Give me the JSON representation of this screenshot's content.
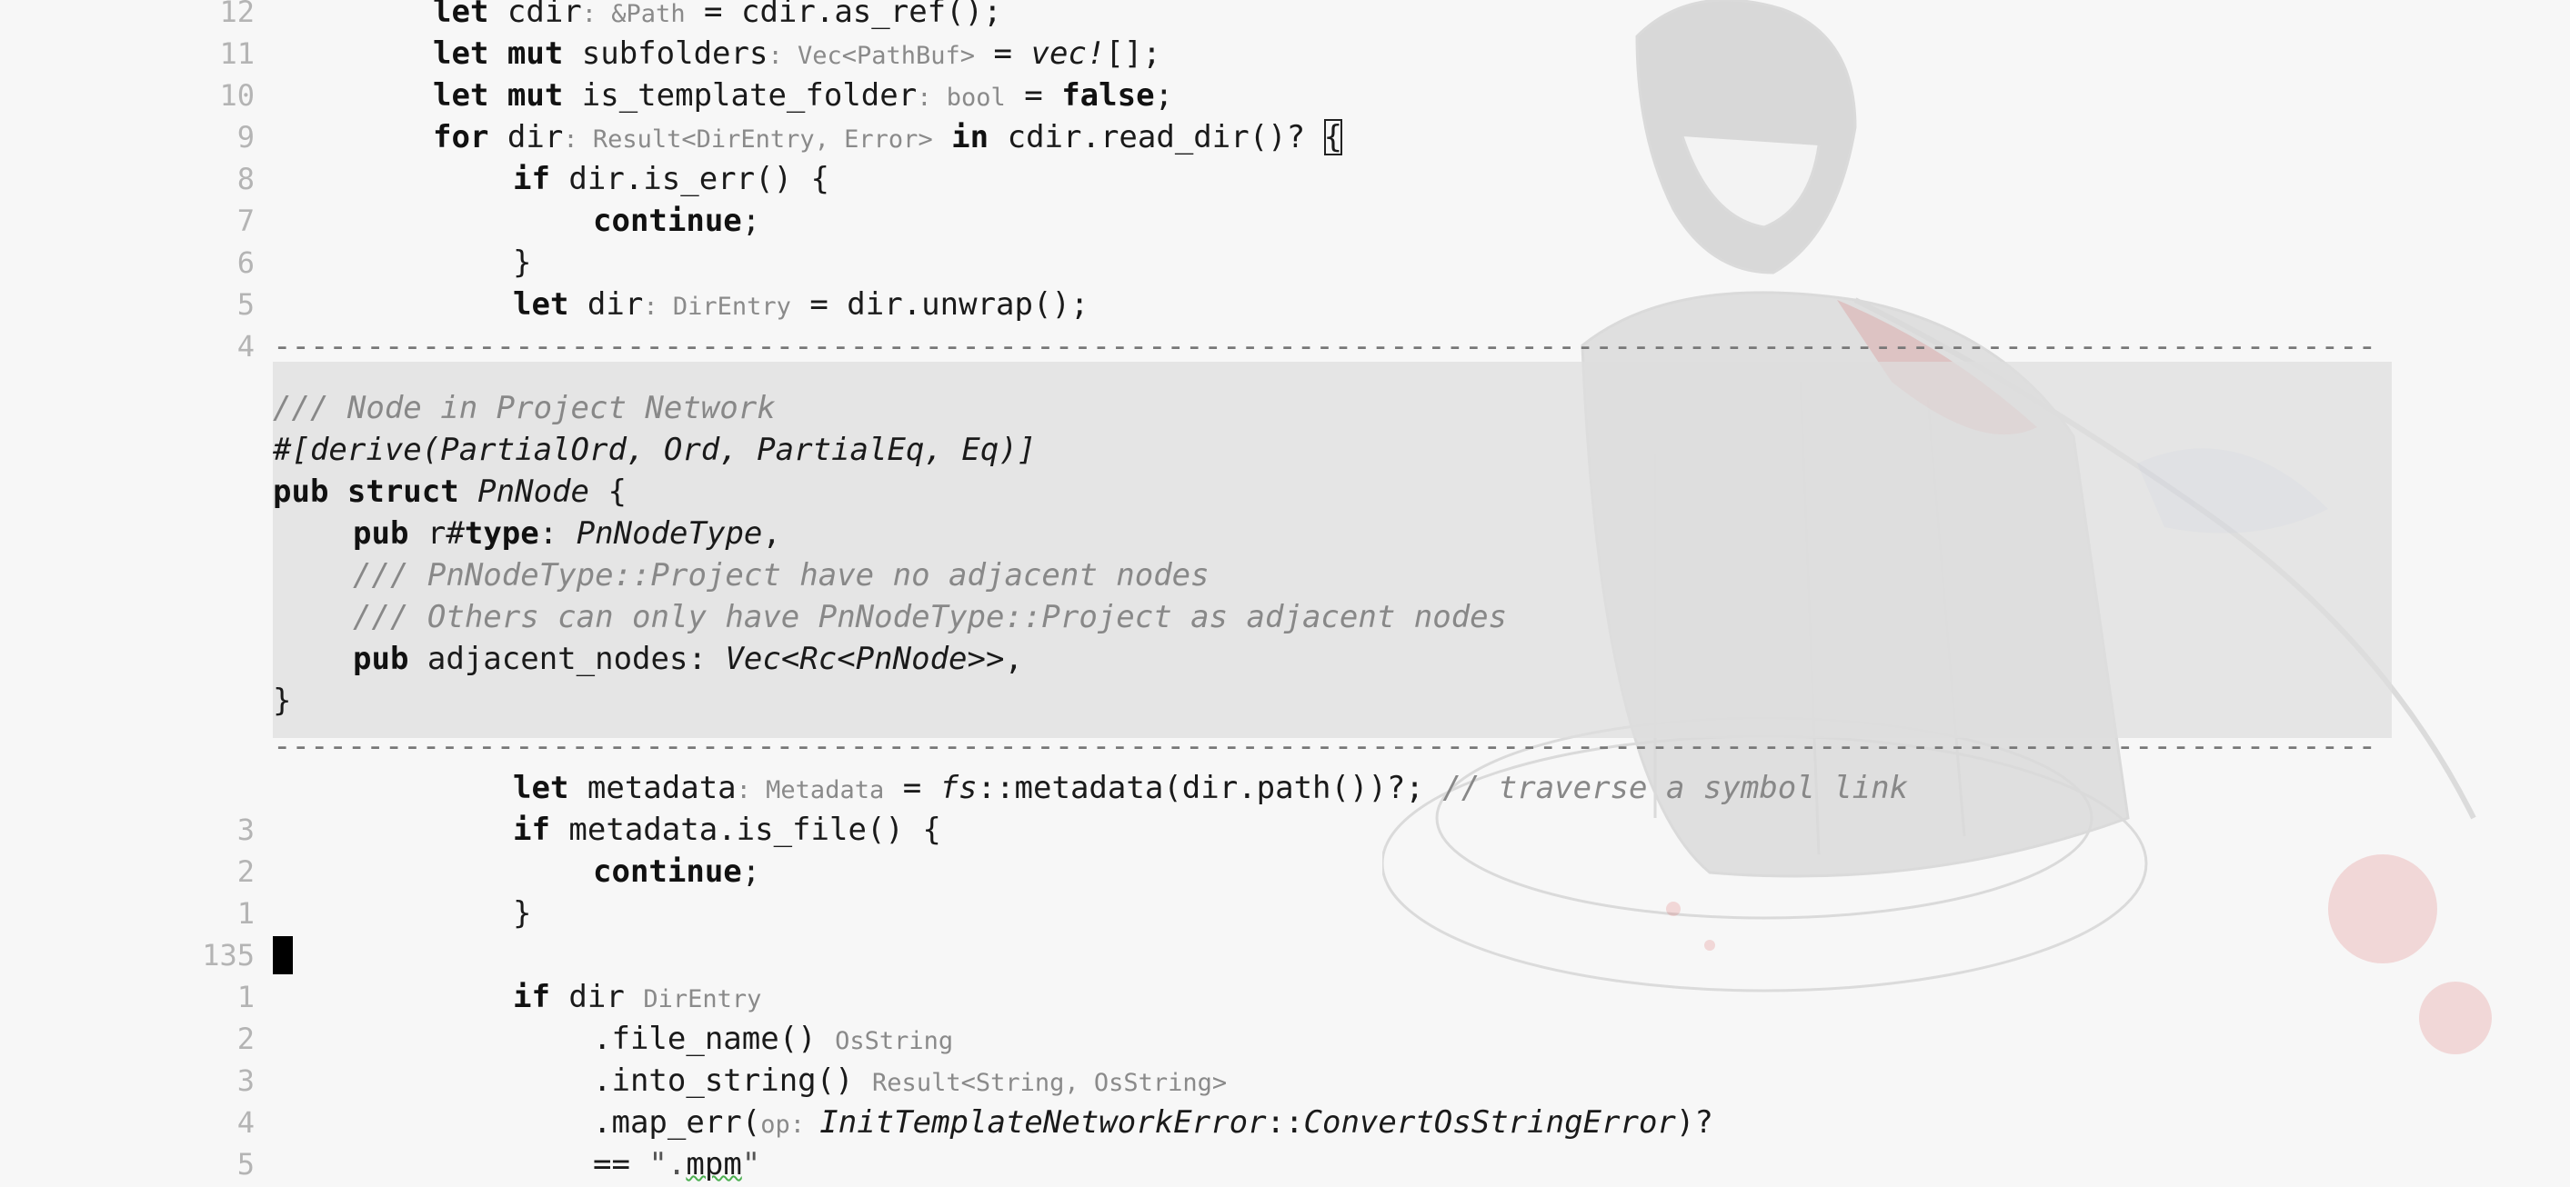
{
  "editor": {
    "lines_top": [
      {
        "num": "12",
        "parts": [
          [
            "kw",
            "let "
          ],
          [
            "",
            "cdir"
          ],
          [
            "hint",
            ": &Path"
          ],
          [
            "",
            " = cdir.as_ref();"
          ]
        ],
        "indent": 2
      },
      {
        "num": "11",
        "parts": [
          [
            "kw",
            "let mut "
          ],
          [
            "",
            "subfolders"
          ],
          [
            "hint",
            ": Vec<PathBuf>"
          ],
          [
            "",
            " = "
          ],
          [
            "it",
            "vec!"
          ],
          [
            "",
            "[];"
          ]
        ],
        "indent": 2
      },
      {
        "num": "10",
        "parts": [
          [
            "kw",
            "let mut "
          ],
          [
            "",
            "is_template_folder"
          ],
          [
            "hint",
            ": bool"
          ],
          [
            "",
            " = "
          ],
          [
            "kw",
            "false"
          ],
          [
            "",
            ";"
          ]
        ],
        "indent": 2
      },
      {
        "num": "9",
        "parts": [
          [
            "kw",
            "for "
          ],
          [
            "",
            "dir"
          ],
          [
            "hint",
            ": Result<DirEntry, Error>"
          ],
          [
            "kw",
            " in "
          ],
          [
            "",
            "cdir.read_dir()? "
          ],
          [
            "bracket",
            "{"
          ]
        ],
        "indent": 2
      },
      {
        "num": "8",
        "parts": [
          [
            "kw",
            "if "
          ],
          [
            "",
            "dir.is_err() {"
          ]
        ],
        "indent": 3
      },
      {
        "num": "7",
        "parts": [
          [
            "kw",
            "continue"
          ],
          [
            "",
            ";"
          ]
        ],
        "indent": 4
      },
      {
        "num": "6",
        "parts": [
          [
            "",
            "}"
          ]
        ],
        "indent": 3
      },
      {
        "num": "5",
        "parts": [
          [
            "kw",
            "let "
          ],
          [
            "",
            "dir"
          ],
          [
            "hint",
            ": DirEntry"
          ],
          [
            "",
            " = dir.unwrap();"
          ]
        ],
        "indent": 3
      }
    ],
    "sep_top_num": "4",
    "popup_lines": [
      {
        "parts": [
          [
            "cm",
            "/// Node in Project Network"
          ]
        ],
        "indent": 0
      },
      {
        "parts": [
          [
            "it",
            "#[derive(PartialOrd, Ord, PartialEq, Eq)]"
          ]
        ],
        "indent": 0
      },
      {
        "parts": [
          [
            "kw",
            "pub struct "
          ],
          [
            "it",
            "PnNode"
          ],
          [
            "",
            " {"
          ]
        ],
        "indent": 0
      },
      {
        "parts": [
          [
            "kw",
            "pub "
          ],
          [
            "",
            "r#"
          ],
          [
            "kw",
            "type"
          ],
          [
            "",
            ": "
          ],
          [
            "it",
            "PnNodeType"
          ],
          [
            "",
            ","
          ]
        ],
        "indent": 1
      },
      {
        "parts": [
          [
            "cm",
            "/// PnNodeType::Project have no adjacent nodes"
          ]
        ],
        "indent": 1
      },
      {
        "parts": [
          [
            "cm",
            "/// Others can only have PnNodeType::Project as adjacent nodes"
          ]
        ],
        "indent": 1
      },
      {
        "parts": [
          [
            "kw",
            "pub "
          ],
          [
            "",
            "adjacent_nodes: "
          ],
          [
            "it",
            "Vec<Rc<PnNode>>"
          ],
          [
            "",
            ","
          ]
        ],
        "indent": 1
      },
      {
        "parts": [
          [
            "",
            "}"
          ]
        ],
        "indent": 0
      }
    ],
    "lines_bottom": [
      {
        "num": "",
        "parts": [
          [
            "kw",
            "let "
          ],
          [
            "",
            "metadata"
          ],
          [
            "hint",
            ": Metadata"
          ],
          [
            "",
            " = "
          ],
          [
            "it",
            "fs"
          ],
          [
            "",
            "::metadata(dir.path())?; "
          ],
          [
            "cm",
            "// traverse a symbol link"
          ]
        ],
        "indent": 3
      },
      {
        "num": "3",
        "parts": [
          [
            "kw",
            "if "
          ],
          [
            "",
            "metadata.is_file() {"
          ]
        ],
        "indent": 3
      },
      {
        "num": "2",
        "parts": [
          [
            "kw",
            "continue"
          ],
          [
            "",
            ";"
          ]
        ],
        "indent": 4
      },
      {
        "num": "1",
        "parts": [
          [
            "",
            "}"
          ]
        ],
        "indent": 3
      },
      {
        "num": "135",
        "parts": [],
        "indent": 0,
        "cursor": true
      },
      {
        "num": "1",
        "parts": [
          [
            "kw",
            "if "
          ],
          [
            "",
            "dir "
          ],
          [
            "hint",
            "DirEntry"
          ]
        ],
        "indent": 3
      },
      {
        "num": "2",
        "parts": [
          [
            "",
            ".file_name() "
          ],
          [
            "hint",
            "OsString"
          ]
        ],
        "indent": 4
      },
      {
        "num": "3",
        "parts": [
          [
            "",
            ".into_string() "
          ],
          [
            "hint",
            "Result<String, OsString>"
          ]
        ],
        "indent": 4
      },
      {
        "num": "4",
        "parts": [
          [
            "",
            ".map_err("
          ],
          [
            "hint",
            "op: "
          ],
          [
            "it",
            "InitTemplateNetworkError"
          ],
          [
            "",
            "::"
          ],
          [
            "it",
            "ConvertOsStringError"
          ],
          [
            "",
            ")?"
          ]
        ],
        "indent": 4
      },
      {
        "num": "5",
        "parts": [
          [
            "",
            "== "
          ],
          [
            "str",
            "\"."
          ],
          [
            "squiggle",
            "mpm"
          ],
          [
            "str",
            "\""
          ]
        ],
        "indent": 4
      }
    ]
  }
}
